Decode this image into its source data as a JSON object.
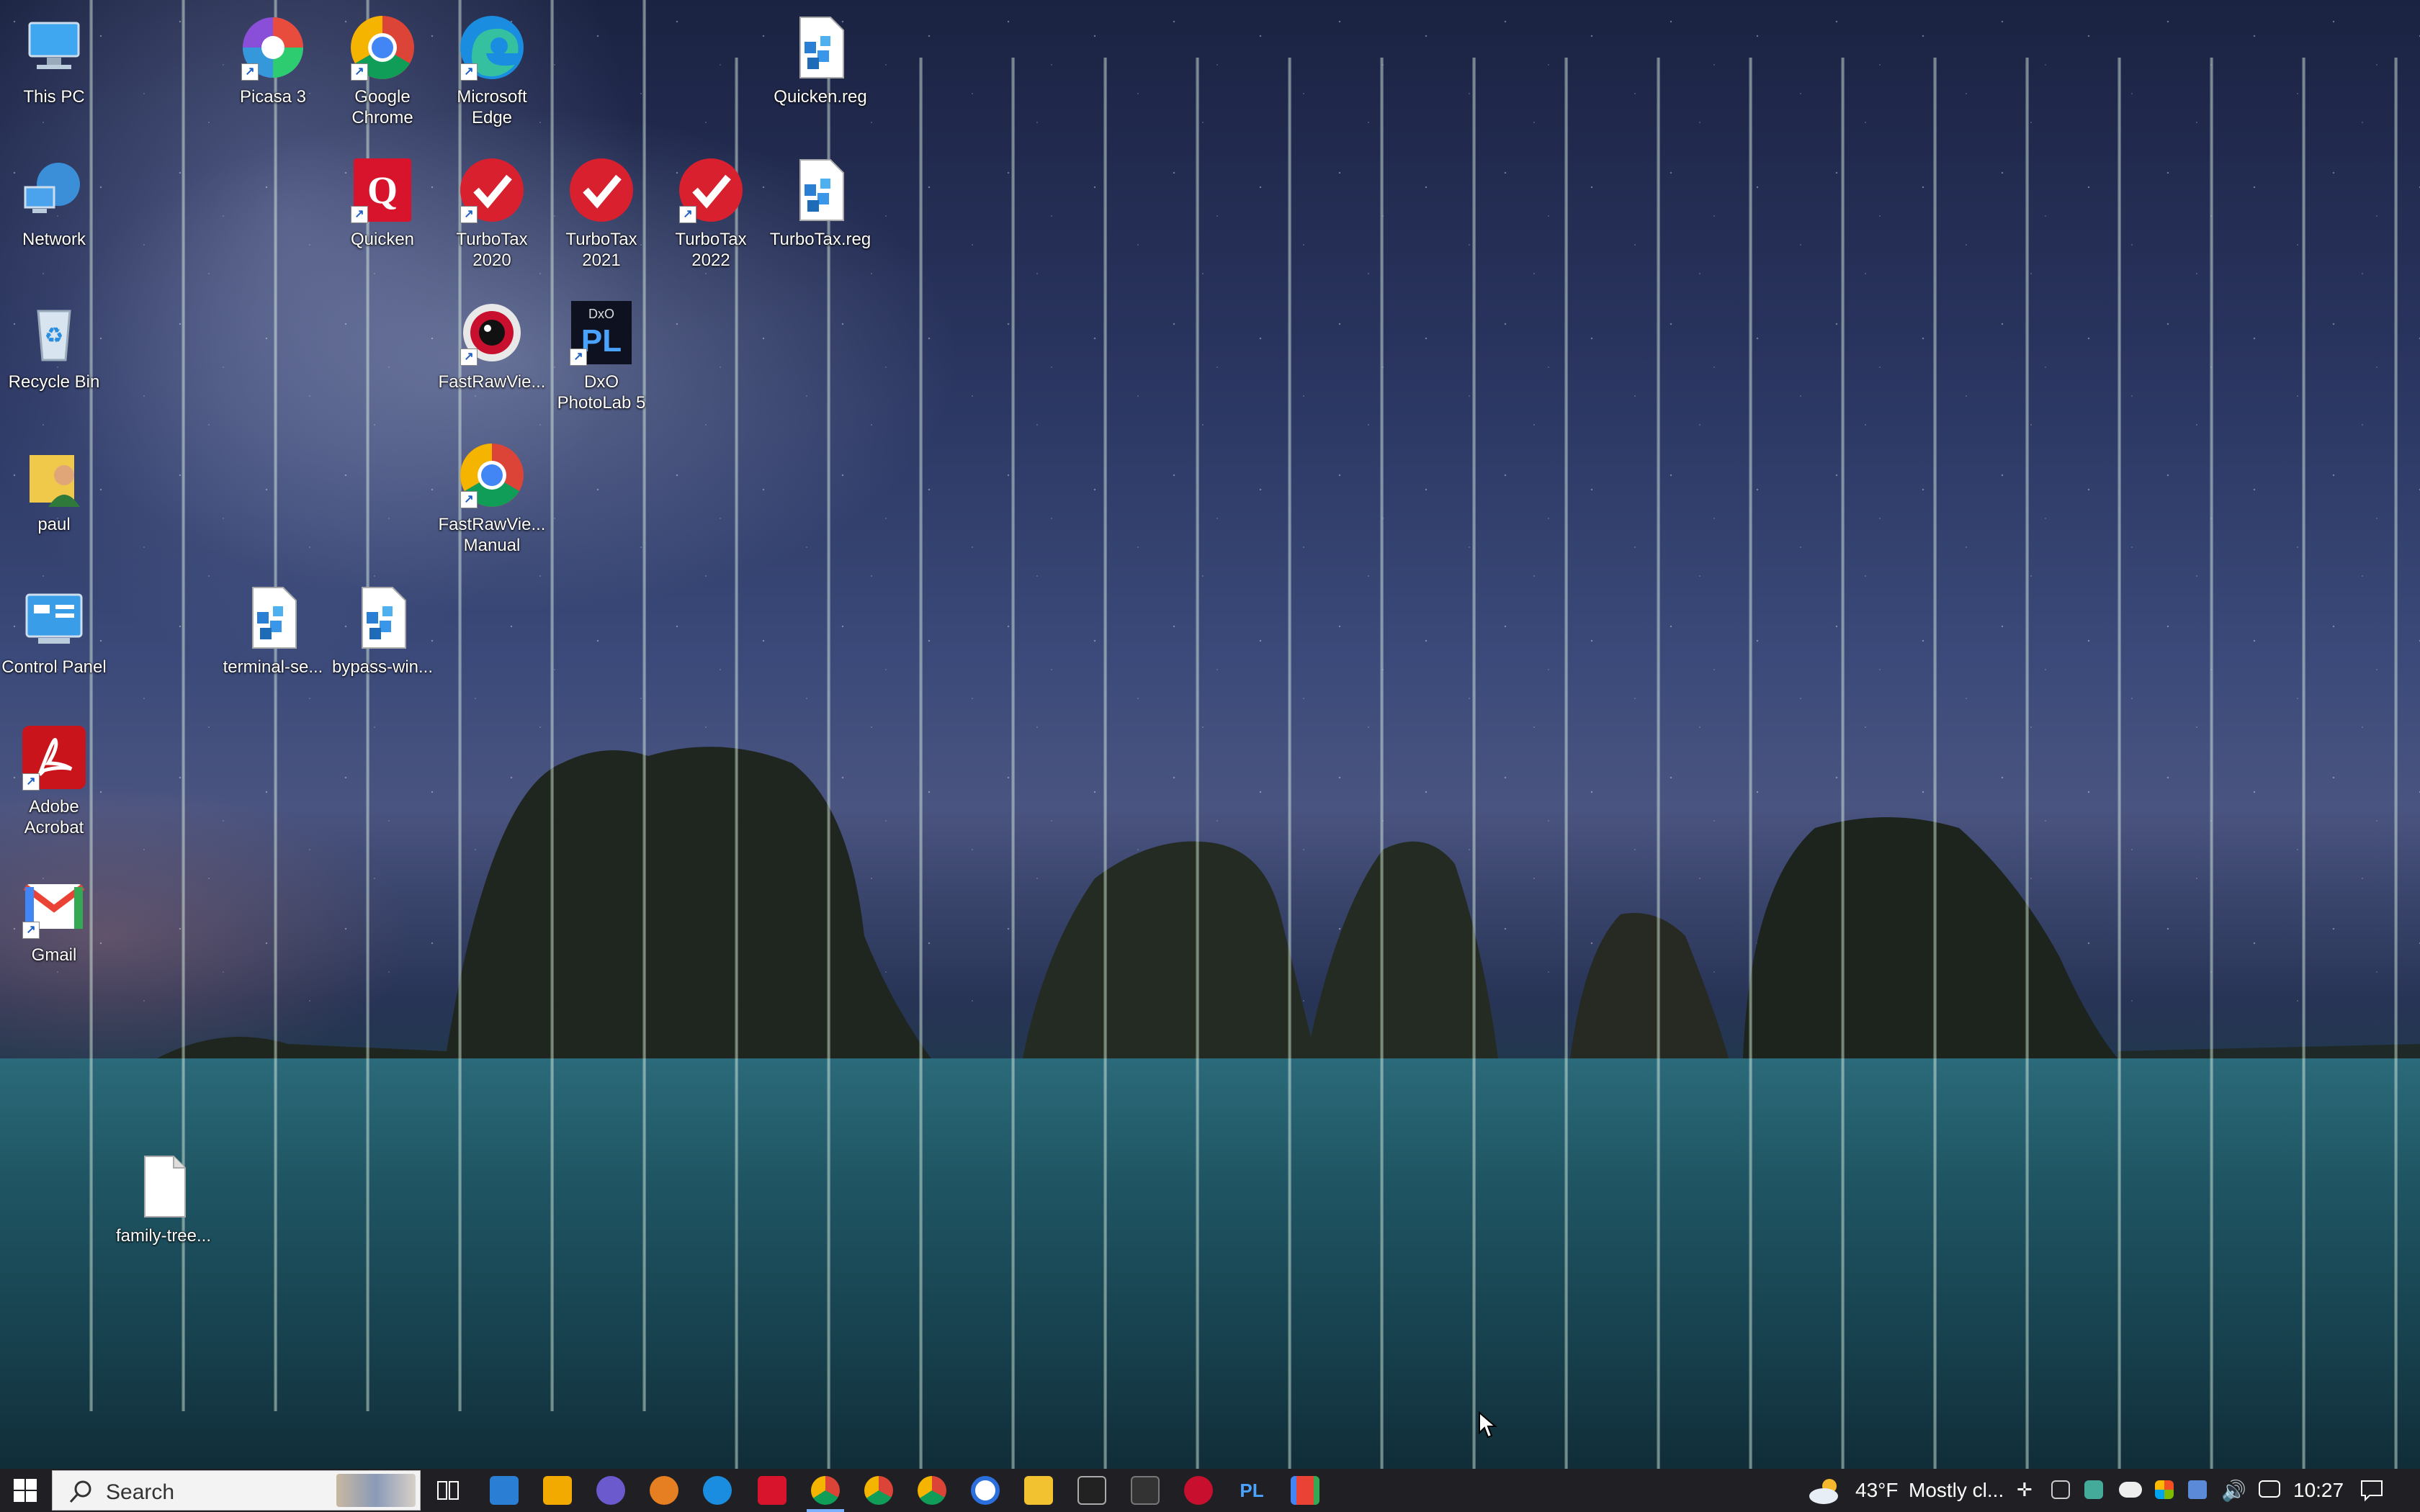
{
  "desktop": {
    "icons": [
      {
        "label": "This PC",
        "icon": "this-pc-icon"
      },
      {
        "label": "Network",
        "icon": "network-icon"
      },
      {
        "label": "Recycle Bin",
        "icon": "recycle-bin-icon"
      },
      {
        "label": "paul",
        "icon": "user-folder-icon"
      },
      {
        "label": "Control Panel",
        "icon": "control-panel-icon"
      },
      {
        "label": "Adobe\nAcrobat",
        "icon": "adobe-acrobat-icon"
      },
      {
        "label": "Gmail",
        "icon": "gmail-icon"
      },
      {
        "label": "Picasa 3",
        "icon": "picasa-icon"
      },
      {
        "label": "Google\nChrome",
        "icon": "chrome-icon"
      },
      {
        "label": "Microsoft\nEdge",
        "icon": "edge-icon"
      },
      {
        "label": "Quicken.reg",
        "icon": "registry-file-icon"
      },
      {
        "label": "Quicken",
        "icon": "quicken-icon"
      },
      {
        "label": "TurboTax\n2020",
        "icon": "turbotax-icon"
      },
      {
        "label": "TurboTax\n2021",
        "icon": "turbotax-icon"
      },
      {
        "label": "TurboTax\n2022",
        "icon": "turbotax-icon"
      },
      {
        "label": "TurboTax.reg",
        "icon": "registry-file-icon"
      },
      {
        "label": "FastRawVie...",
        "icon": "fastrawviewer-icon"
      },
      {
        "label": "DxO\nPhotoLab 5",
        "icon": "dxo-photolab-icon"
      },
      {
        "label": "FastRawVie...\nManual",
        "icon": "chrome-icon"
      },
      {
        "label": "terminal-se...",
        "icon": "registry-file-icon"
      },
      {
        "label": "bypass-win...",
        "icon": "registry-file-icon"
      },
      {
        "label": "family-tree...",
        "icon": "blank-file-icon"
      }
    ]
  },
  "taskbar": {
    "search_placeholder": "Search",
    "weather_temp": "43°F",
    "weather_desc": "Mostly cl...",
    "clock": "10:27",
    "apps": [
      "task-view",
      "control-panel",
      "microsoft-store",
      "app",
      "app",
      "edge",
      "quicken",
      "chrome",
      "chrome",
      "chrome",
      "signal",
      "file-explorer",
      "command-prompt",
      "terminal",
      "fastrawviewer",
      "dxo-photolab",
      "gmail"
    ]
  },
  "colors": {
    "taskbar_bg": "#1f1f24",
    "active_indicator": "#7ab0ff"
  }
}
